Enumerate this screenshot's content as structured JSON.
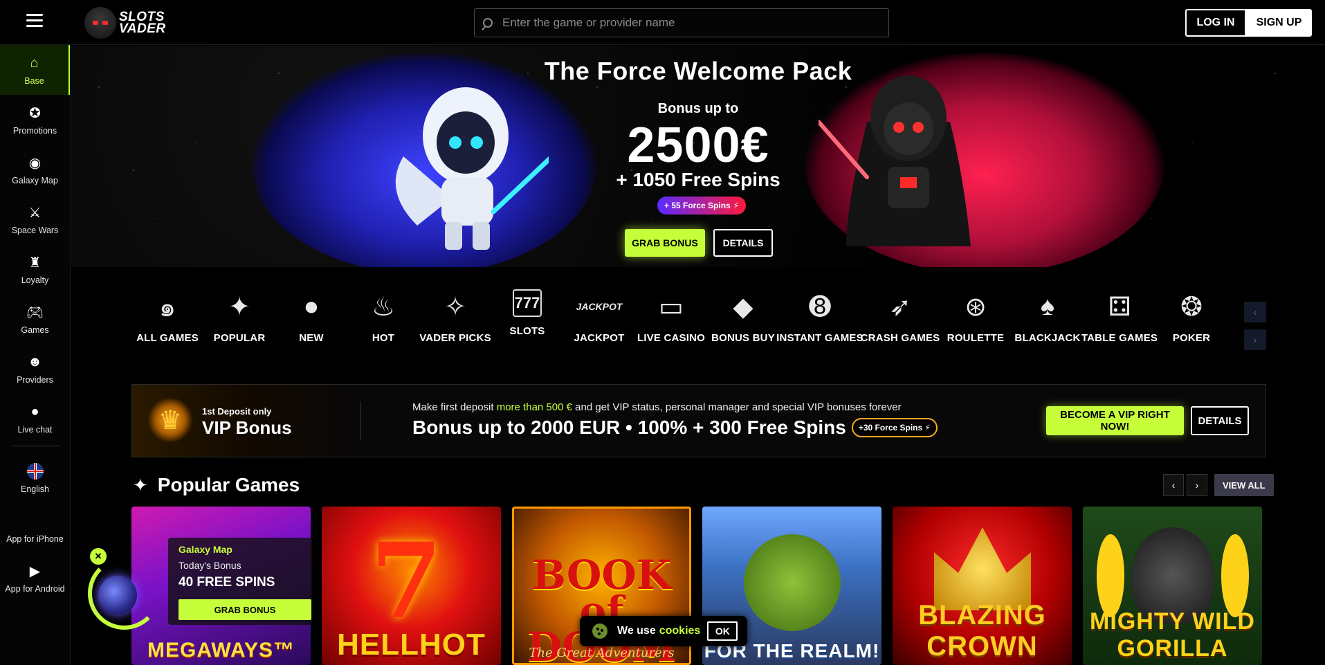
{
  "header": {
    "logo_line1": "SLOTS",
    "logo_line2": "VADER",
    "search_placeholder": "Enter the game or provider name",
    "login_label": "LOG IN",
    "signup_label": "SIGN UP"
  },
  "sidebar": {
    "items": [
      {
        "label": "Base",
        "icon": "home-icon",
        "active": true
      },
      {
        "label": "Promotions",
        "icon": "promotions-icon"
      },
      {
        "label": "Galaxy Map",
        "icon": "galaxy-icon"
      },
      {
        "label": "Space Wars",
        "icon": "crossed-swords-icon"
      },
      {
        "label": "Loyalty",
        "icon": "loyalty-icon"
      },
      {
        "label": "Games",
        "icon": "gamepad-icon"
      },
      {
        "label": "Providers",
        "icon": "providers-icon"
      },
      {
        "label": "Live chat",
        "icon": "chat-icon"
      },
      {
        "label": "English",
        "icon": "uk-flag-icon"
      },
      {
        "label": "App for iPhone",
        "icon": "apple-icon"
      },
      {
        "label": "App for Android",
        "icon": "play-store-icon"
      }
    ]
  },
  "hero": {
    "title": "The Force Welcome Pack",
    "bonus_up": "Bonus up to",
    "amount": "2500€",
    "spins": "+ 1050 Free Spins",
    "force_pill": "+ 55 Force Spins",
    "grab_label": "GRAB BONUS",
    "details_label": "DETAILS"
  },
  "categories": [
    {
      "label": "ALL GAMES",
      "icon": "galaxy-swirl-icon"
    },
    {
      "label": "POPULAR",
      "icon": "sparkle-icon"
    },
    {
      "label": "NEW",
      "icon": "planet-icon"
    },
    {
      "label": "HOT",
      "icon": "flame-icon"
    },
    {
      "label": "VADER PICKS",
      "icon": "compass-star-icon"
    },
    {
      "label": "SLOTS",
      "icon": "slot-machine-icon"
    },
    {
      "label": "JACKPOT",
      "icon": "jackpot-icon"
    },
    {
      "label": "LIVE CASINO",
      "icon": "live-dealer-icon"
    },
    {
      "label": "BONUS BUY",
      "icon": "diamond-icon"
    },
    {
      "label": "INSTANT GAMES",
      "icon": "eight-ball-icon"
    },
    {
      "label": "CRASH GAMES",
      "icon": "rocket-icon"
    },
    {
      "label": "ROULETTE",
      "icon": "roulette-icon"
    },
    {
      "label": "BLACKJACK",
      "icon": "cards-icon"
    },
    {
      "label": "TABLE GAMES",
      "icon": "dice-icon"
    },
    {
      "label": "POKER",
      "icon": "poker-chip-icon"
    }
  ],
  "vip": {
    "small": "1st Deposit only",
    "big": "VIP Bonus",
    "desc_pre": "Make first deposit ",
    "desc_hl": "more than 500 €",
    "desc_post": " and get VIP status, personal manager and special VIP bonuses forever",
    "headline": "Bonus up to 2000 EUR • 100% + 300 Free Spins",
    "pill": "+30 Force Spins",
    "cta_label": "BECOME A VIP RIGHT NOW!",
    "details_label": "DETAILS"
  },
  "popular": {
    "title": "Popular Games",
    "view_all": "VIEW ALL",
    "games": [
      {
        "title": "MEGAWAYS™"
      },
      {
        "title": "HELLHOT"
      },
      {
        "title": "BOOK of DOOM",
        "subtitle": "The Great Adventurers"
      },
      {
        "title": "FOR THE REALM!"
      },
      {
        "title": "BLAZING CROWN"
      },
      {
        "title": "MIGHTY WILD GORILLA"
      }
    ]
  },
  "galaxy_widget": {
    "title": "Galaxy Map",
    "subtitle": "Today's Bonus",
    "spins": "40 FREE SPINS",
    "button": "GRAB BONUS"
  },
  "cookie": {
    "text": "We use",
    "link": "cookies",
    "ok": "OK"
  },
  "colors": {
    "accent": "#c6ff3a",
    "background": "#000000"
  }
}
